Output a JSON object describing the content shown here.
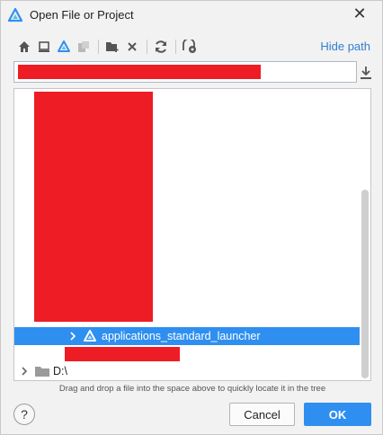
{
  "window": {
    "title": "Open File or Project",
    "close_glyph": "✕"
  },
  "toolbar": {
    "buttons": [
      {
        "icon": "home-icon"
      },
      {
        "icon": "desktop-icon"
      },
      {
        "icon": "project-icon"
      },
      {
        "icon": "module-icon"
      },
      {
        "icon": "new-folder-icon"
      },
      {
        "icon": "delete-icon"
      },
      {
        "icon": "refresh-icon"
      },
      {
        "icon": "show-hidden-icon"
      }
    ],
    "hide_path_label": "Hide path"
  },
  "path_field": {
    "value_redacted": true
  },
  "tree": {
    "selected_item": {
      "label": "applications_standard_launcher",
      "icon": "project-icon"
    },
    "drive_item": {
      "label": "D:\\",
      "icon": "folder-icon"
    }
  },
  "hint": "Drag and drop a file into the space above to quickly locate it in the tree",
  "footer": {
    "help_label": "?",
    "cancel_label": "Cancel",
    "ok_label": "OK"
  },
  "colors": {
    "accent": "#2f8ff0",
    "link": "#2f7fd1",
    "redaction": "#ee1c25"
  }
}
